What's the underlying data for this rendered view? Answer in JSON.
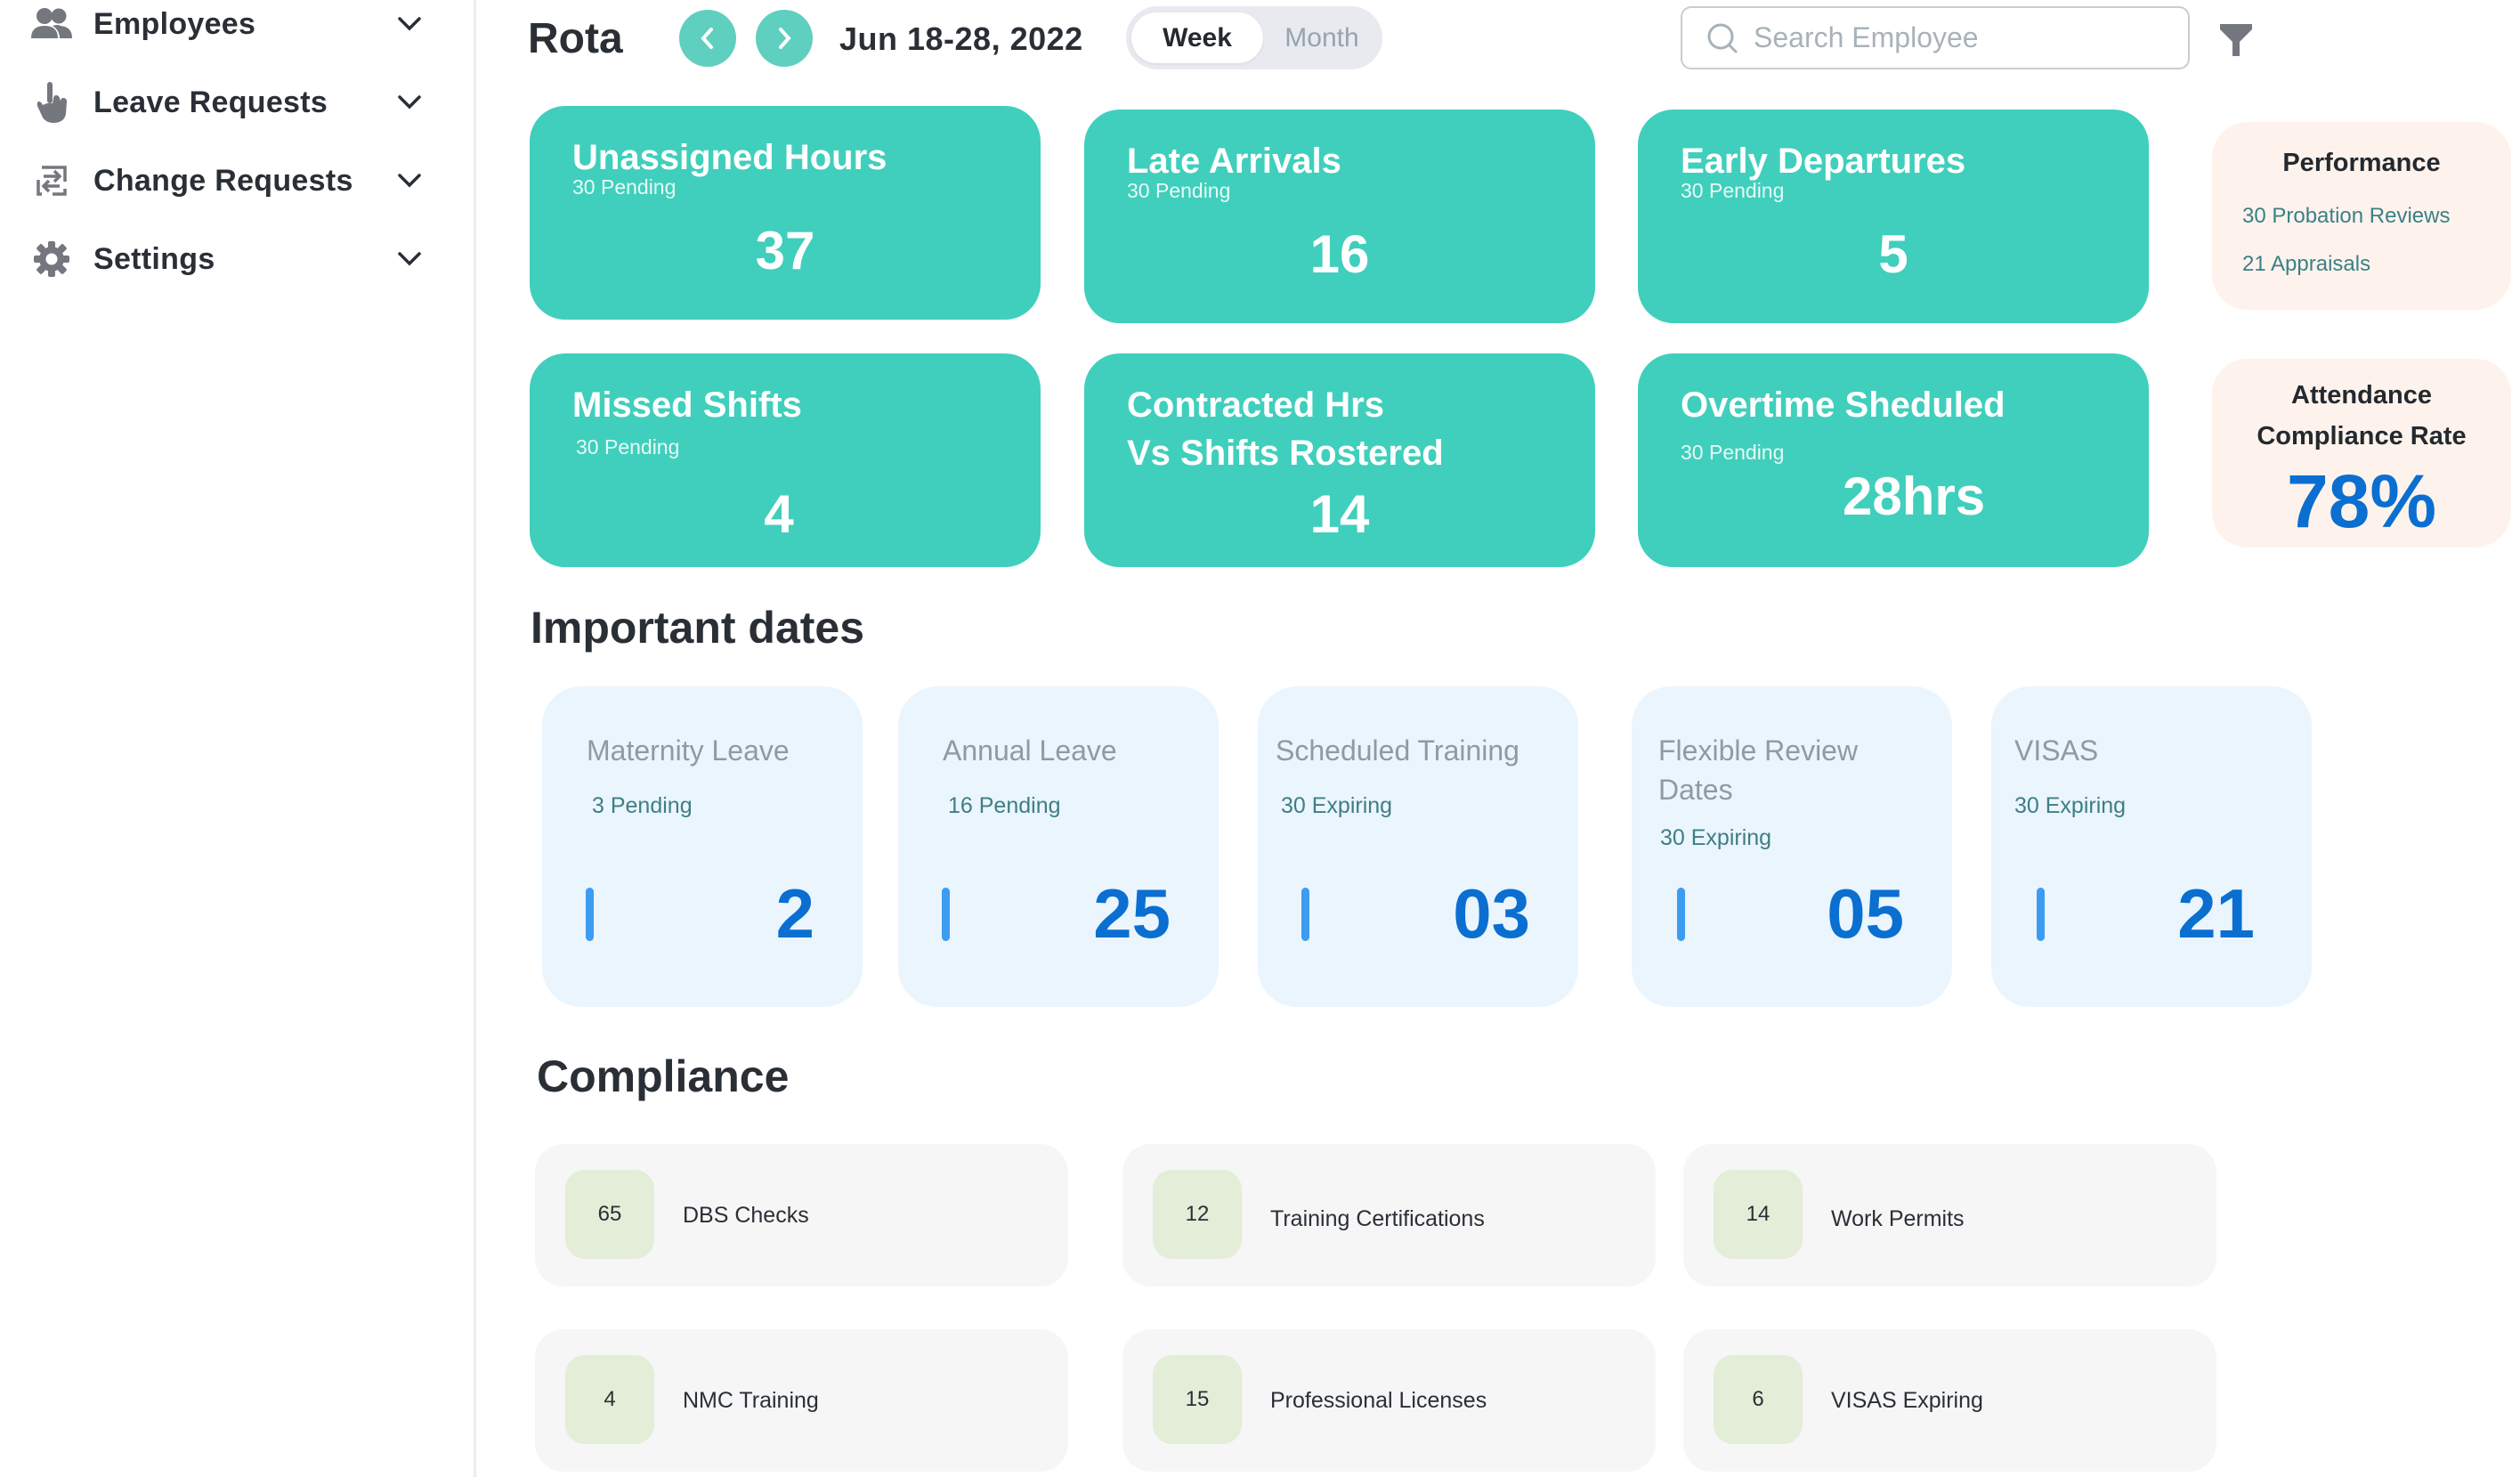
{
  "sidebar": {
    "items": [
      {
        "label": "Employees",
        "icon": "users-icon"
      },
      {
        "label": "Leave Requests",
        "icon": "hand-pointer-icon"
      },
      {
        "label": "Change Requests",
        "icon": "swap-arrows-icon"
      },
      {
        "label": "Settings",
        "icon": "gear-icon"
      }
    ]
  },
  "header": {
    "title": "Rota",
    "prev_icon": "chevron-left-icon",
    "next_icon": "chevron-right-icon",
    "date_range": "Jun 18-28, 2022",
    "view_toggle": {
      "options": [
        "Week",
        "Month"
      ],
      "selected": "Week"
    },
    "search": {
      "placeholder": "Search Employee",
      "value": ""
    },
    "filter_icon": "filter-icon"
  },
  "stats": [
    {
      "title": "Unassigned Hours",
      "subtitle": "30 Pending",
      "value": "37"
    },
    {
      "title": "Late Arrivals",
      "subtitle": "30 Pending",
      "value": "16"
    },
    {
      "title": "Early Departures",
      "subtitle": "30 Pending",
      "value": "5"
    },
    {
      "title": "Missed Shifts",
      "subtitle": "30 Pending",
      "value": "4"
    },
    {
      "title_line1": "Contracted Hrs",
      "title_line2": "Vs Shifts Rostered",
      "value": "14"
    },
    {
      "title": "Overtime Sheduled",
      "subtitle": "30 Pending",
      "value": "28hrs"
    }
  ],
  "performance": {
    "title": "Performance",
    "lines": [
      "30 Probation Reviews",
      "21 Appraisals"
    ]
  },
  "attendance": {
    "title_line1": "Attendance",
    "title_line2": "Compliance Rate",
    "value": "78%"
  },
  "important_dates": {
    "heading": "Important dates",
    "cards": [
      {
        "title": "Maternity Leave",
        "subtitle": "3 Pending",
        "value": "2"
      },
      {
        "title": "Annual Leave",
        "subtitle": "16 Pending",
        "value": "25"
      },
      {
        "title": "Scheduled Training",
        "subtitle": "30 Expiring",
        "value": "03"
      },
      {
        "title": "Flexible Review Dates",
        "subtitle": "30 Expiring",
        "value": "05"
      },
      {
        "title": "VISAS",
        "subtitle": "30 Expiring",
        "value": "21"
      }
    ]
  },
  "compliance": {
    "heading": "Compliance",
    "items": [
      {
        "count": "65",
        "label": "DBS Checks"
      },
      {
        "count": "12",
        "label": "Training Certifications"
      },
      {
        "count": "14",
        "label": "Work Permits"
      },
      {
        "count": "4",
        "label": "NMC Training"
      },
      {
        "count": "15",
        "label": "Professional Licenses"
      },
      {
        "count": "6",
        "label": "VISAS Expiring"
      }
    ]
  },
  "colors": {
    "teal_card": "#40cfbc",
    "nav_button": "#5fcfbf",
    "accent_blue": "#0a6fd0",
    "date_card_bg": "#eaf5fe",
    "panel_bg": "#fdf3ec",
    "compliance_badge": "#e3edd7"
  }
}
